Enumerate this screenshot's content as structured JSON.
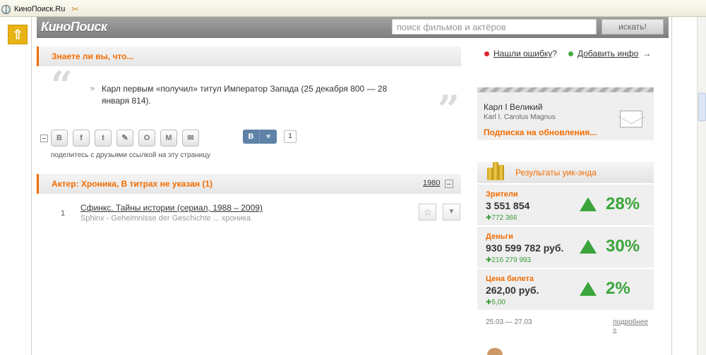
{
  "browser": {
    "tab_title": "КиноПоиск.Ru"
  },
  "header": {
    "logo": "КиноПоиск",
    "search_placeholder": "поиск фильмов и актёров",
    "search_button": "искать!"
  },
  "did_you_know": {
    "title": "Знаете ли вы, что...",
    "bullet": "»",
    "fact": "Карл первым «получил» титул Император Запада (25 декабря 800 — 28 января 814).",
    "share_icons": [
      "vkontakte-icon",
      "facebook-icon",
      "twitter-icon",
      "livejournal-icon",
      "odnoklassniki-icon",
      "moimir-icon",
      "email-icon"
    ],
    "share_glyphs": [
      "В",
      "f",
      "t",
      "✎",
      "О",
      "М",
      "✉"
    ],
    "share_caption": "поделитесь с друзьями ссылкой на эту страницу",
    "vk_like_letter": "В",
    "vk_like_heart": "♥",
    "vk_like_count": "1"
  },
  "filmography": {
    "title": "Актер: Хроника, В титрах не указан (1)",
    "year_link": "1980",
    "films": [
      {
        "num": "1",
        "title": "Сфинкс. Тайны истории (сериал, 1988 – 2009)",
        "subtitle": "Sphinx - Geheimnisse der Geschichte ... хроника"
      }
    ],
    "star_glyph": "☆",
    "dropdown_glyph": "▼"
  },
  "actions": {
    "report_error": "Нашли ошибку",
    "report_error_q": "?",
    "add_info": "Добавить инфо",
    "add_info_arrow": "→"
  },
  "person": {
    "name": "Карл I Великий",
    "original": "Karl I. Carolus Magnus",
    "subscribe": "Подписка на обновления..."
  },
  "weekend": {
    "title": "Результаты уик-энда",
    "blocks": [
      {
        "label": "Зрители",
        "value": "3 551 854",
        "delta": "772 366",
        "percent": "28%"
      },
      {
        "label": "Деньги",
        "value": "930 599 782 руб.",
        "delta": "216 279 993",
        "percent": "30%"
      },
      {
        "label": "Цена билета",
        "value": "262,00 руб.",
        "delta": "5,00",
        "percent": "2%"
      }
    ],
    "delta_sign": "✚",
    "dates": "25.03 — 27.03",
    "more": "подробнее",
    "more_arrow": "»"
  }
}
